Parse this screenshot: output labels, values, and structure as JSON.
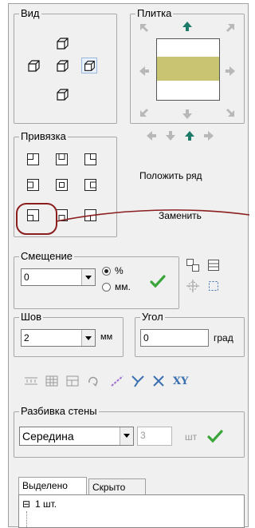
{
  "groups": {
    "view": "Вид",
    "tile": "Плитка",
    "snap": "Привязка",
    "offset": "Смещение",
    "seam": "Шов",
    "angle": "Угол",
    "wall_split": "Разбивка стены"
  },
  "tile_actions": {
    "place_row": "Положить ряд",
    "replace": "Заменить"
  },
  "offset": {
    "value": "0",
    "radio_percent": "%",
    "radio_mm": "мм.",
    "selected": "%"
  },
  "seam": {
    "value": "2",
    "unit": "мм"
  },
  "angle": {
    "value": "0",
    "unit": "град"
  },
  "wall_split": {
    "mode": "Середина",
    "count": "3",
    "unit": "шт"
  },
  "tabs": [
    "Выделено",
    "Скрыто"
  ],
  "tree": {
    "root_label": "1 шт.",
    "expander": "⊟"
  },
  "toolbar_xy": "XY",
  "colors": {
    "tile_fill": "#c8c472",
    "accent_arrow": "#1f7a6a",
    "check_green": "#3aa63a",
    "highlight_circle": "#8b1e1e"
  },
  "icons": [
    "cube-icon",
    "arrow-icon",
    "snap-corner-icon",
    "checkmark-icon",
    "distribute-icon",
    "angle-icon",
    "cross-icon"
  ]
}
